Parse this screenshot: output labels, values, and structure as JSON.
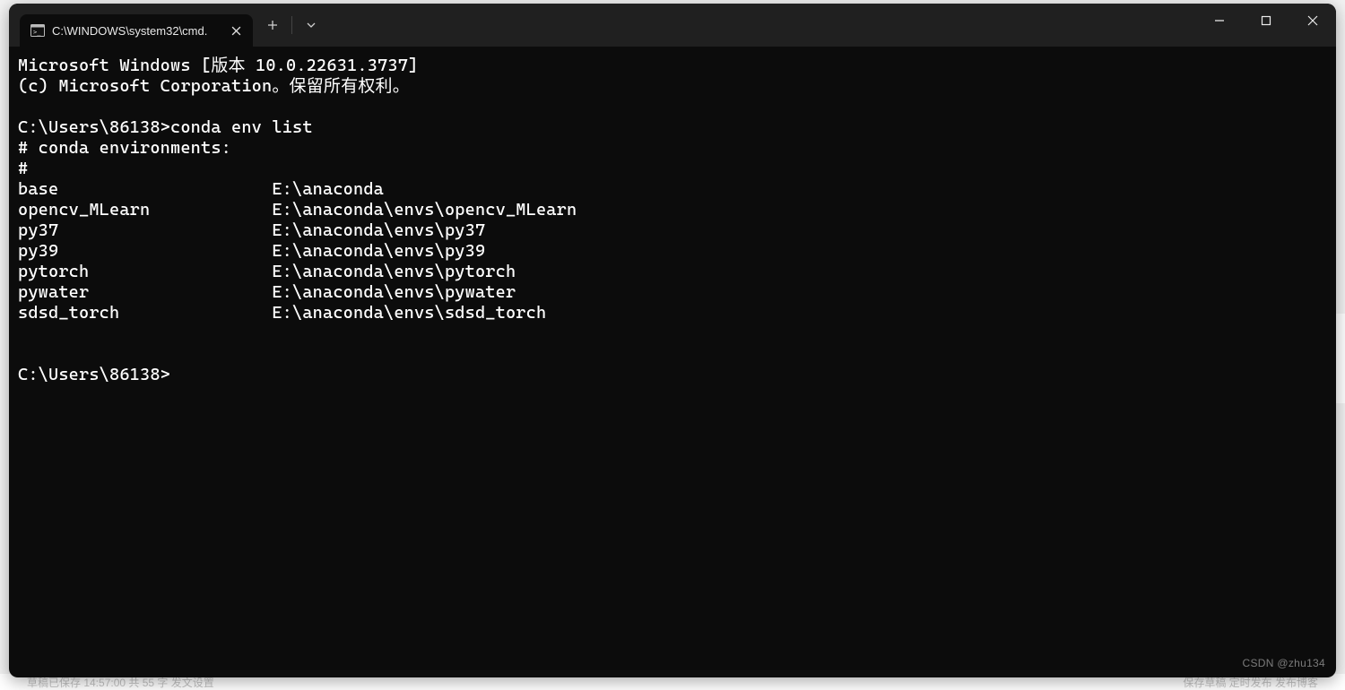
{
  "tab": {
    "title": "C:\\WINDOWS\\system32\\cmd."
  },
  "banner": {
    "line1": "Microsoft Windows [版本 10.0.22631.3737]",
    "line2": "(c) Microsoft Corporation。保留所有权利。"
  },
  "prompt1": {
    "path": "C:\\Users\\86138>",
    "command": "conda env list"
  },
  "env_header1": "# conda environments:",
  "env_header2": "#",
  "envs": [
    {
      "name": "base",
      "path": "E:\\anaconda"
    },
    {
      "name": "opencv_MLearn",
      "path": "E:\\anaconda\\envs\\opencv_MLearn"
    },
    {
      "name": "py37",
      "path": "E:\\anaconda\\envs\\py37"
    },
    {
      "name": "py39",
      "path": "E:\\anaconda\\envs\\py39"
    },
    {
      "name": "pytorch",
      "path": "E:\\anaconda\\envs\\pytorch"
    },
    {
      "name": "pywater",
      "path": "E:\\anaconda\\envs\\pywater"
    },
    {
      "name": "sdsd_torch",
      "path": "E:\\anaconda\\envs\\sdsd_torch"
    }
  ],
  "prompt2": {
    "path": "C:\\Users\\86138>"
  },
  "watermark": "CSDN @zhu134",
  "underlay": {
    "left": "草稿已保存 14:57:00   共 55 字   发文设置",
    "right": "保存草稿      定时发布      发布博客"
  }
}
